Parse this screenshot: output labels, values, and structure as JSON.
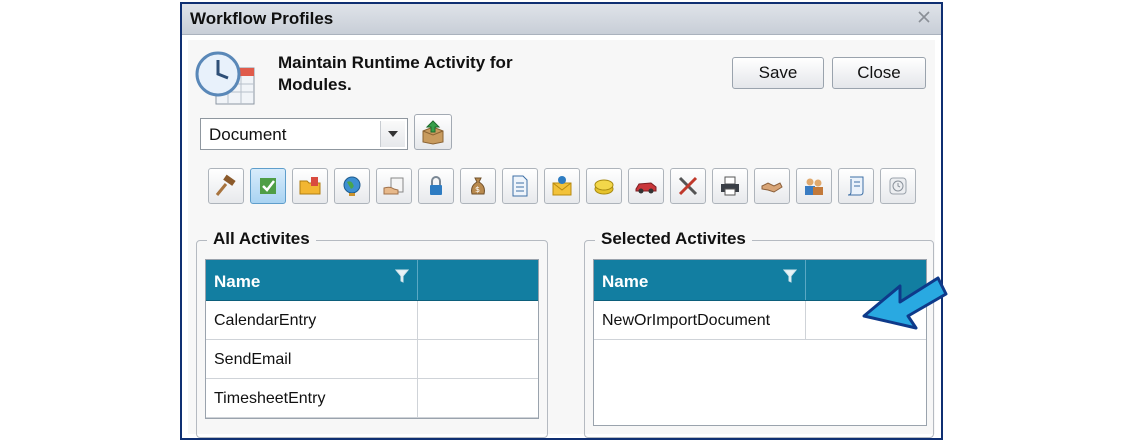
{
  "window": {
    "title": "Workflow Profiles"
  },
  "header": {
    "text": "Maintain Runtime Activity for Modules."
  },
  "buttons": {
    "save": "Save",
    "close": "Close"
  },
  "module_select": {
    "value": "Document"
  },
  "toolbar": {
    "icons": [
      "gavel-icon",
      "checklist-icon",
      "folder-icon",
      "globe-icon",
      "hand-document-icon",
      "lock-icon",
      "money-bag-icon",
      "document-icon",
      "mail-icon",
      "coins-icon",
      "car-icon",
      "tools-icon",
      "printer-icon",
      "handshake-icon",
      "people-icon",
      "scroll-icon",
      "clock-icon"
    ],
    "active_index": 1
  },
  "all_activities": {
    "legend": "All Activites",
    "column": "Name",
    "rows": [
      "CalendarEntry",
      "SendEmail",
      "TimesheetEntry"
    ]
  },
  "selected_activities": {
    "legend": "Selected Activites",
    "column": "Name",
    "rows": [
      "NewOrImportDocument"
    ]
  },
  "colors": {
    "grid_header": "#127ea1",
    "title_border": "#0f2f72",
    "annotation_arrow": "#29a9e1"
  }
}
